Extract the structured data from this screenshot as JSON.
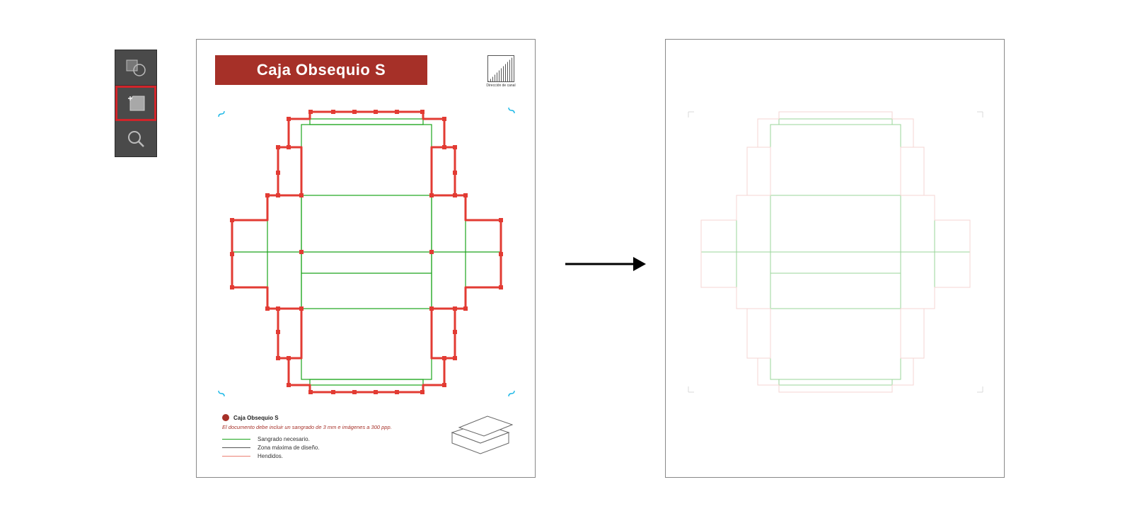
{
  "toolbar": {
    "tools": [
      "shape-builder-tool",
      "artboard-tool",
      "zoom-tool"
    ],
    "selected": "artboard-tool"
  },
  "artboard_left": {
    "title": "Caja Obsequio S",
    "channel_label": "Dirección de canal",
    "legend": {
      "header": "Caja Obsequio S",
      "note": "El documento debe incluir un sangrado de 3 mm e imágenes a 300 ppp.",
      "rows": [
        {
          "swatch": "green",
          "label": "Sangrado necesario."
        },
        {
          "swatch": "black",
          "label": "Zona máxima de diseño."
        },
        {
          "swatch": "red",
          "label": "Hendidos."
        }
      ]
    }
  },
  "colors": {
    "brand_red": "#a63028",
    "cut_red": "#e23b33",
    "fold_green": "#1ca51c",
    "cyan": "#16b6e6",
    "toolbar_bg": "#4a4a4a",
    "highlight": "#d1242a",
    "black": "#000"
  }
}
